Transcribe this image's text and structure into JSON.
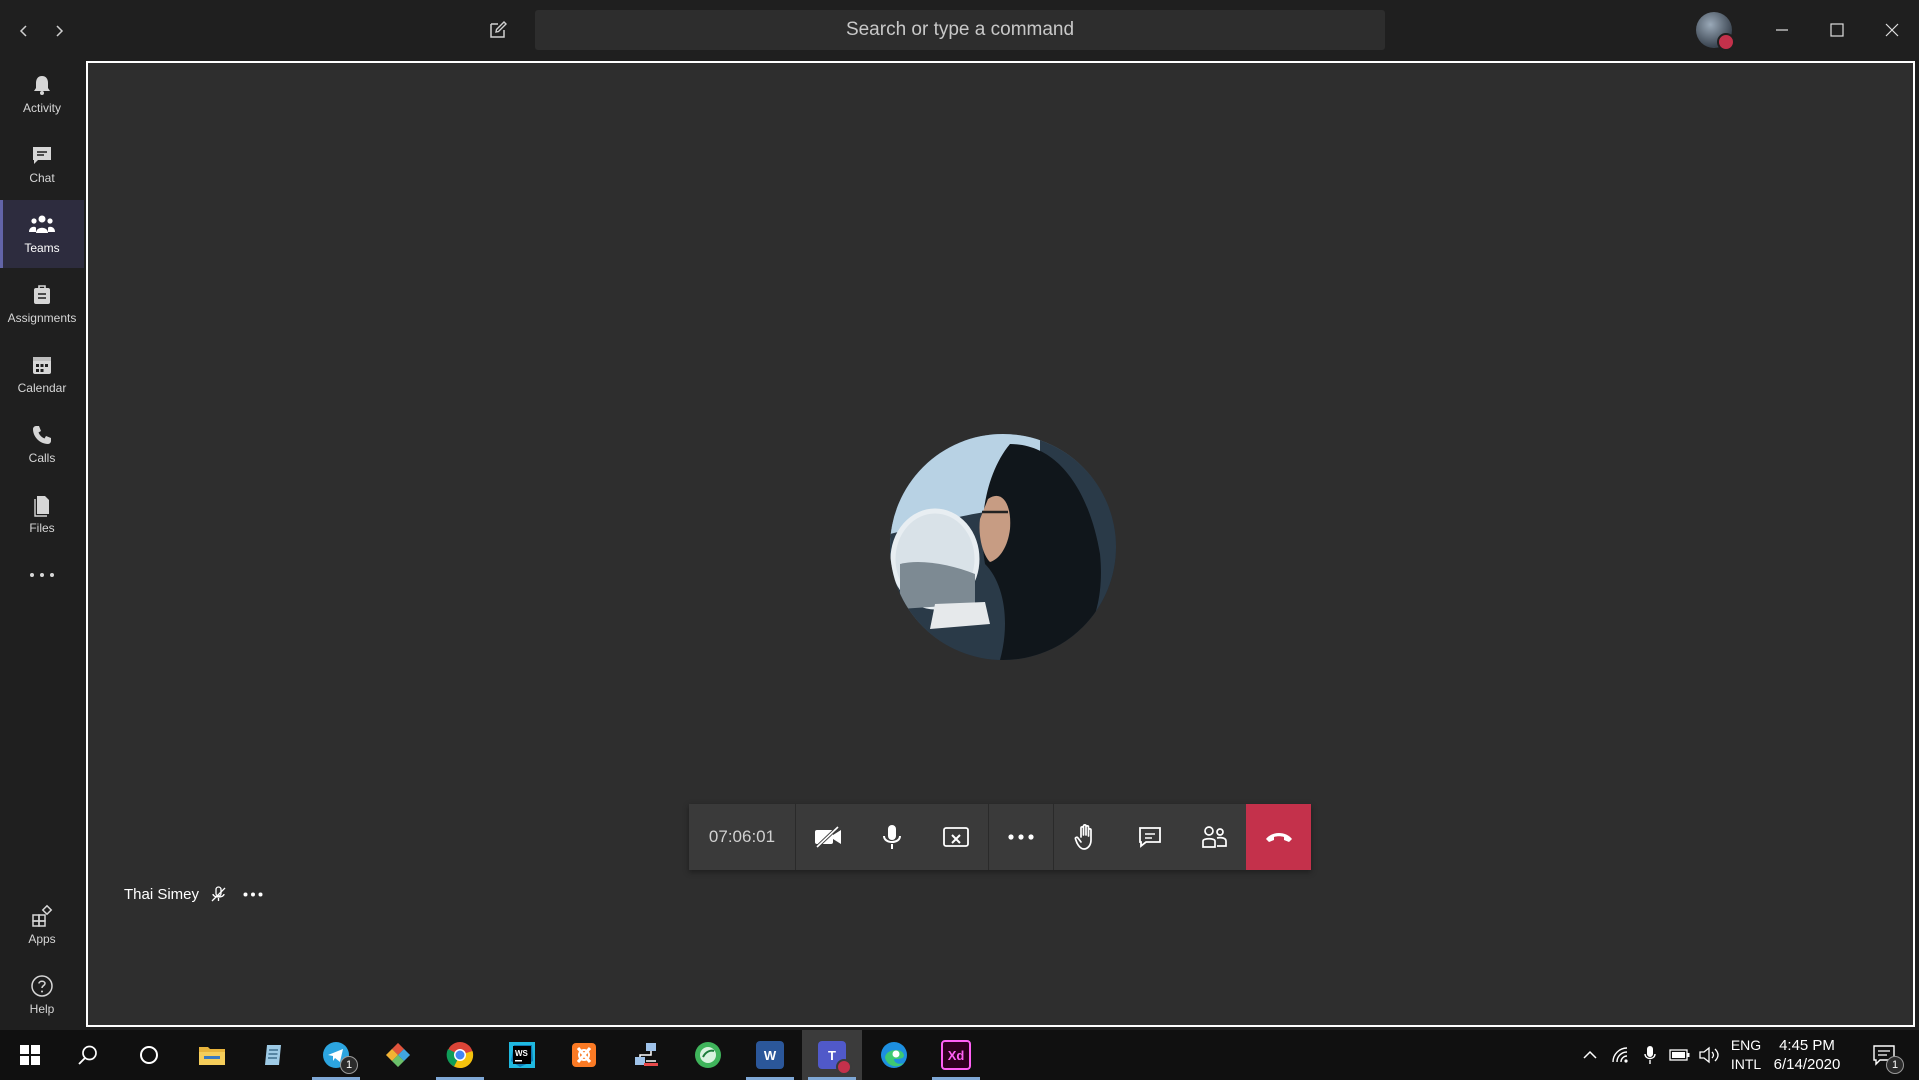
{
  "titlebar": {
    "search_placeholder": "Search or type a command"
  },
  "sidebar": {
    "items": [
      {
        "label": "Activity",
        "icon": "bell-icon"
      },
      {
        "label": "Chat",
        "icon": "chat-icon"
      },
      {
        "label": "Teams",
        "icon": "teams-icon",
        "active": true
      },
      {
        "label": "Assignments",
        "icon": "assignments-icon"
      },
      {
        "label": "Calendar",
        "icon": "calendar-icon"
      },
      {
        "label": "Calls",
        "icon": "phone-icon"
      },
      {
        "label": "Files",
        "icon": "files-icon"
      }
    ],
    "apps_label": "Apps",
    "help_label": "Help"
  },
  "call": {
    "participant_name": "Thai Simey",
    "timer": "07:06:01",
    "hangup_color": "#c4314b"
  },
  "taskbar": {
    "apps": [
      "windows-start",
      "search",
      "cortana",
      "file-explorer",
      "notepad",
      "telegram",
      "git-tool",
      "chrome",
      "webstorm",
      "xampp",
      "network-tool",
      "app-green",
      "word",
      "teams",
      "edge",
      "adobe-xd"
    ],
    "telegram_badge": "1",
    "language": "ENG",
    "keyboard": "INTL",
    "time": "4:45 PM",
    "date": "6/14/2020",
    "notification_count": "1"
  },
  "colors": {
    "accent": "#6264a7",
    "background": "#1f1f1f",
    "stage": "#2e2e2e"
  }
}
